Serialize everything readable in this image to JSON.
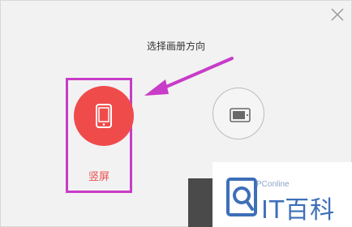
{
  "dialog": {
    "title": "选择画册方向",
    "options": {
      "portrait": {
        "label": "竖屏",
        "selected": true
      },
      "landscape": {
        "label": "",
        "selected": false
      }
    }
  },
  "colors": {
    "accent": "#ef4b4b",
    "highlight": "#c83cc8",
    "arrow": "#c83cc8"
  },
  "icons": {
    "close": "close-icon",
    "portrait": "tablet-portrait-icon",
    "landscape": "tablet-landscape-icon",
    "watermark": "pconline-logo-icon"
  },
  "watermark": {
    "site": "PConline",
    "brand": "IT百科"
  }
}
